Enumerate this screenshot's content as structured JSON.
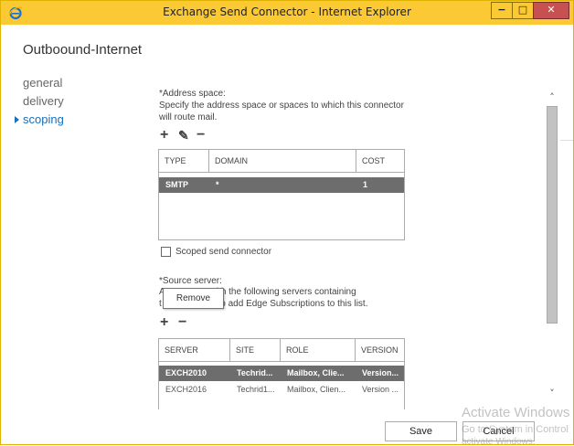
{
  "window": {
    "title": "Exchange Send Connector - Internet Explorer",
    "controls": {
      "minimize": "−",
      "maximize": "□",
      "close": "✕"
    }
  },
  "page": {
    "heading": "Outboound-Internet"
  },
  "nav": {
    "items": [
      {
        "label": "general",
        "active": false
      },
      {
        "label": "delivery",
        "active": false
      },
      {
        "label": "scoping",
        "active": true
      }
    ]
  },
  "address_space": {
    "label": "*Address space:",
    "description": "Specify the address space or spaces to which this connector will route mail.",
    "tools": {
      "add": "+",
      "edit": "✎",
      "remove": "−"
    },
    "columns": [
      "TYPE",
      "DOMAIN",
      "COST"
    ],
    "rows": [
      {
        "type": "SMTP",
        "domain": "*",
        "cost": "1",
        "selected": true
      }
    ]
  },
  "scoped": {
    "label": "Scoped send connector",
    "checked": false
  },
  "source_server": {
    "label": "*Source server:",
    "desc_line1": "A            connector with the following servers containing",
    "desc_line2": "t             s. You can also add Edge Subscriptions to this list.",
    "tooltip": "Remove",
    "tools": {
      "add": "+",
      "remove": "−"
    },
    "columns": [
      "SERVER",
      "SITE",
      "ROLE",
      "VERSION"
    ],
    "rows": [
      {
        "server": "EXCH2010",
        "site": "Techrid...",
        "role": "Mailbox, Clie...",
        "version": "Version...",
        "selected": true
      },
      {
        "server": "EXCH2016",
        "site": "Techrid1...",
        "role": "Mailbox, Clien...",
        "version": "Version ...",
        "selected": false
      }
    ]
  },
  "scroll": {
    "up": "˄",
    "down": "˅"
  },
  "footer": {
    "save": "Save",
    "cancel": "Cancel"
  },
  "watermark": {
    "line1": "Activate Windows",
    "line2": "Go to System in Control",
    "line3": "activate Windows."
  },
  "colors": {
    "titlebar": "#fbc933",
    "accent": "#1a6fb5",
    "selected_row": "#6d6d6d"
  }
}
